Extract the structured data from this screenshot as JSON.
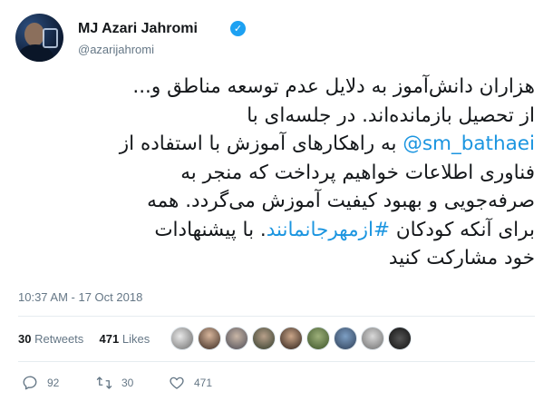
{
  "author": {
    "name": "MJ Azari Jahromi",
    "handle": "@azarijahromi",
    "verified_mark": "✓"
  },
  "tweet": {
    "line1": "هزاران دانش‌آموز به دلایل عدم توسعه مناطق و...",
    "line2": "از تحصیل بازمانده‌اند. در جلسه‌ای با",
    "mention": "@sm_bathaei",
    "line3_text": " به راهکارهای آموزش با استفاده از",
    "line4": "فناوری اطلاعات خواهیم پرداخت که منجر به",
    "line5": "صرفه‌جویی و بهبود کیفیت آموزش می‌گردد. همه",
    "line6_pre": "برای آنکه کودکان ",
    "hashtag": "#ازمهرجانمانند",
    "line6_post": ". با پیشنهادات",
    "line7": "خود مشارکت کنید"
  },
  "timestamp": "10:37 AM - 17 Oct 2018",
  "stats": {
    "retweets_count": "30",
    "retweets_label": "Retweets",
    "likes_count": "471",
    "likes_label": "Likes"
  },
  "actions": {
    "reply_count": "92",
    "retweet_count": "30",
    "like_count": "471"
  },
  "icons": {
    "reply": "reply-icon",
    "retweet": "retweet-icon",
    "like": "heart-icon",
    "verified": "verified-badge-icon"
  },
  "colors": {
    "link": "#1b95e0",
    "verified": "#1da1f2",
    "secondary_text": "#657786",
    "primary_text": "#14171a",
    "divider": "#e6ecf0"
  }
}
